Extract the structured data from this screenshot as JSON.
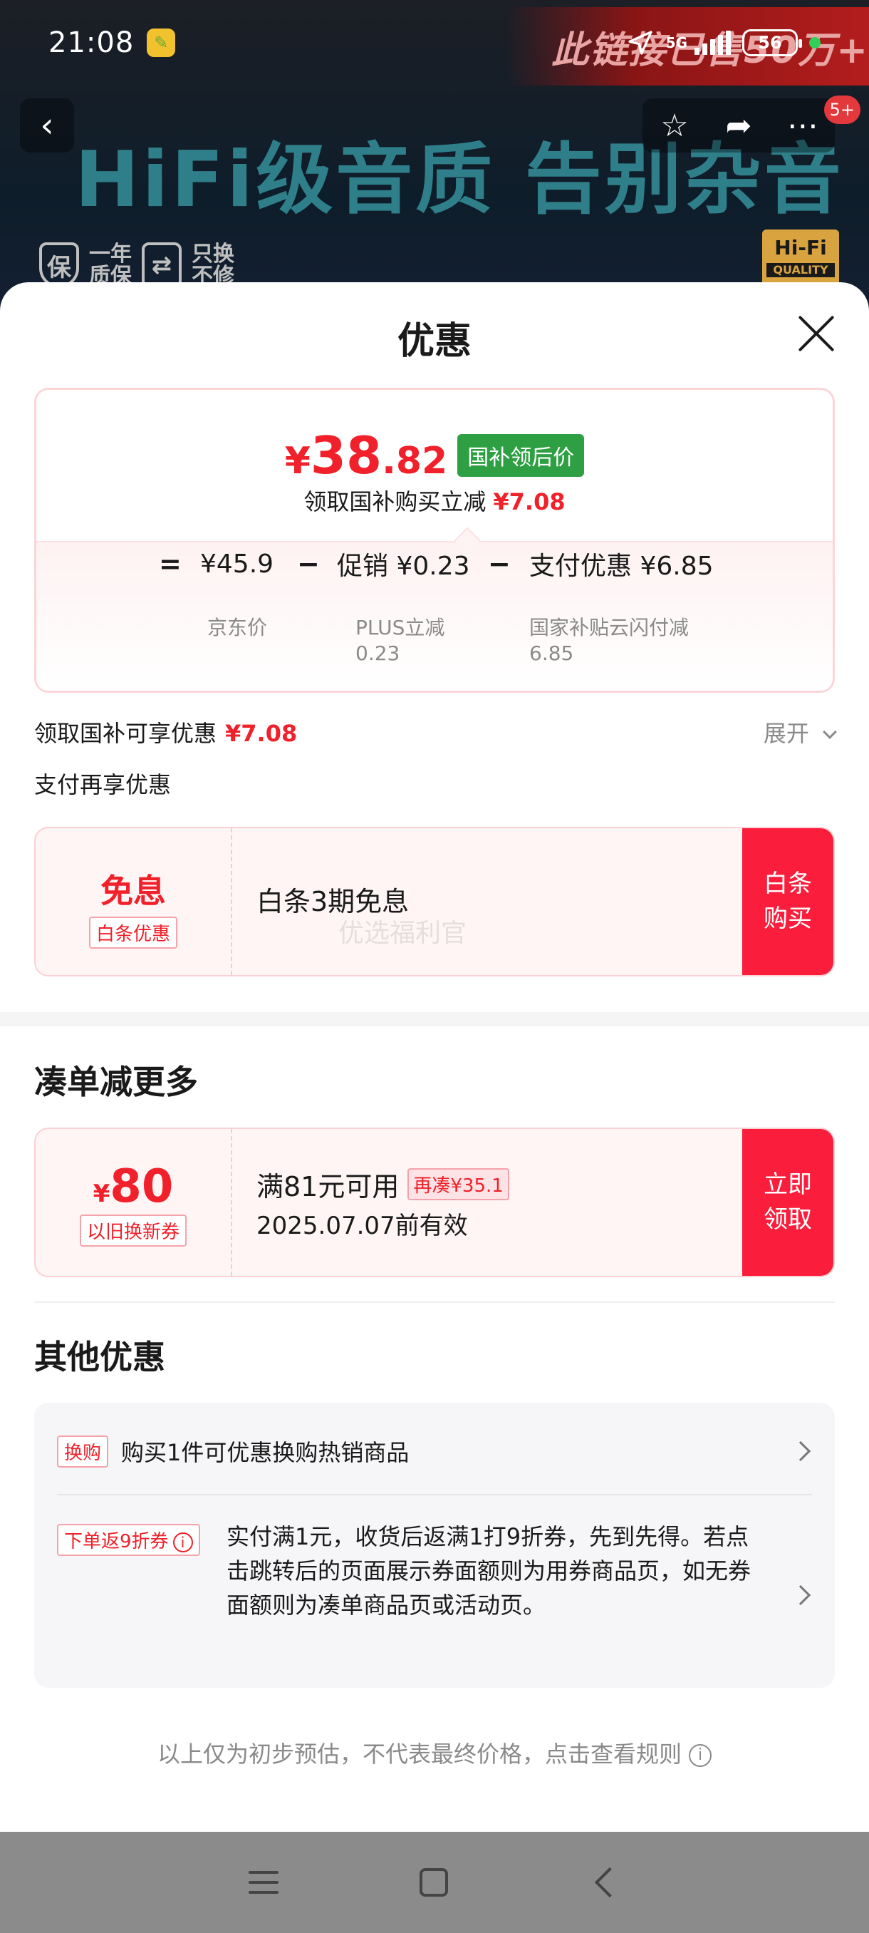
{
  "status_bar": {
    "time": "21:08",
    "network": "5G",
    "battery": "56"
  },
  "background_page": {
    "promo_banner": "此链接已售50万+",
    "hero_text": "HiFi级音质 告别杂音",
    "badge_left_line1": "一年",
    "badge_left_line2": "质保",
    "badge_left_line3": "只换",
    "badge_left_line4": "不修",
    "hifi_logo": "Hi-Fi",
    "hifi_logo_sub": "QUALITY",
    "nav_badge": "5+"
  },
  "sheet": {
    "title": "优惠",
    "price_card": {
      "currency": "¥",
      "price_int": "38",
      "price_dec": ".82",
      "price_tag": "国补领后价",
      "subtitle": "领取国补购买立减",
      "subtitle_amount": "¥7.08",
      "formula": {
        "eq": "=",
        "jd_price": "¥45.9",
        "minus1": "−",
        "promo": "促销 ¥0.23",
        "minus2": "−",
        "pay_discount": "支付优惠 ¥6.85",
        "jd_price_label": "京东价",
        "promo_note_1": "PLUS立减",
        "promo_note_2": "0.23",
        "pay_note_1": "国家补贴云闪付减",
        "pay_note_2": "6.85"
      }
    },
    "subsidy_line": "领取国补可享优惠",
    "subsidy_amount": "¥7.08",
    "expand_label": "展开",
    "pay_more_line": "支付再享优惠",
    "baitiao_coupon": {
      "title": "免息",
      "tag": "白条优惠",
      "desc": "白条3期免息",
      "watermark": "优选福利官",
      "button_line1": "白条",
      "button_line2": "购买"
    },
    "combine_title": "凑单减更多",
    "trade_in_coupon": {
      "currency": "¥",
      "amount": "80",
      "tag": "以旧换新券",
      "condition": "满81元可用",
      "extra_tag": "再凑¥35.1",
      "expiry": "2025.07.07前有效",
      "button_line1": "立即",
      "button_line2": "领取"
    },
    "other_title": "其他优惠",
    "other_items": [
      {
        "tag": "换购",
        "text": "购买1件可优惠换购热销商品"
      },
      {
        "tag": "下单返9折券",
        "text": "实付满1元，收货后返满1打9折券，先到先得。若点击跳转后的页面展示券面额则为用券商品页，如无券面额则为凑单商品页或活动页。"
      }
    ],
    "footer_note": "以上仅为初步预估，不代表最终价格，点击查看规则"
  }
}
